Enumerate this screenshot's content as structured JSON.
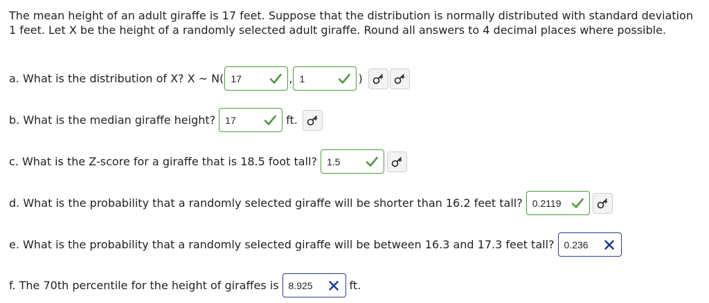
{
  "intro": "The mean height of an adult giraffe is 17 feet. Suppose that the distribution is normally distributed with standard deviation 1 feet. Let X be the height of a randomly selected adult giraffe. Round all answers to 4 decimal places where possible.",
  "questions": {
    "a": {
      "prefix": "a. What is the distribution of X? X ~ N(",
      "answer1": "17",
      "sep": ",",
      "answer2": "1",
      "close": ")",
      "status1": "correct",
      "status2": "correct"
    },
    "b": {
      "prefix": "b. What is the median giraffe height?",
      "answer": "17",
      "suffix": "ft.",
      "status": "correct"
    },
    "c": {
      "prefix": "c. What is the Z-score for a giraffe that is 18.5 foot tall?",
      "answer": "1.5",
      "status": "correct"
    },
    "d": {
      "prefix": "d. What is the probability that a randomly selected giraffe will be shorter than 16.2 feet tall?",
      "answer": "0.2119",
      "status": "correct"
    },
    "e": {
      "prefix": "e. What is the probability that a randomly selected giraffe will be between 16.3 and 17.3 feet tall?",
      "answer": "0.236",
      "status": "incorrect"
    },
    "f": {
      "prefix": "f. The 70th percentile for the height of giraffes is",
      "answer": "8.925",
      "suffix": "ft.",
      "status": "incorrect"
    }
  },
  "icons": {
    "correct": "check-icon",
    "incorrect": "x-icon",
    "key": "key-icon"
  },
  "colors": {
    "correct": "#4a9a3c",
    "incorrect_border": "#2b3a8c",
    "incorrect_mark": "#1f3a9a"
  }
}
